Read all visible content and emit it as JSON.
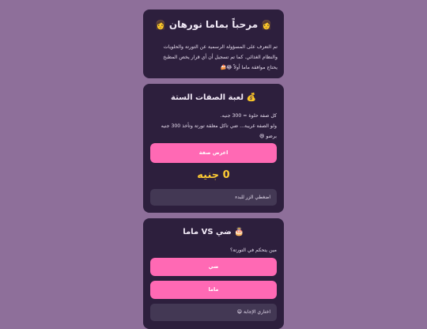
{
  "welcome": {
    "title": "مرحباً بماما نورهان",
    "emoji": "👩",
    "lines": [
      "تم التعرف على المسؤولة الرسمية عن التورتة والحلويات",
      "والنظام الغذائي. كما تم تسجيل أن أي قرار يخص المطبخ",
      "يحتاج موافقة ماما أولاً 😂🍰"
    ]
  },
  "game": {
    "title": "لعبة الصفات الستة",
    "emoji": "💰",
    "lines": [
      "كل صفة حلوة = 300 جنيه.",
      "ولو الصفة غريبة... ضي تاكل معلقة تورتة وتأخذ 300 جنيه",
      "برضو 😄"
    ],
    "show_button": "اعرض صفة",
    "amount": "0 جنيه",
    "prompt_box": "اضغطي الزر للبدء"
  },
  "vs": {
    "title": "ضي VS ماما",
    "emoji": "🎂",
    "question": "مين يتحكم في التورتة؟",
    "option_1": "ضي",
    "option_2": "ماما",
    "answer_box": "اختاري الإجابة 😄"
  },
  "colors": {
    "background": "#8e6f9a",
    "card": "#2d1f3d",
    "accent_pink": "#ff69b4",
    "gold": "#ffcc33"
  }
}
